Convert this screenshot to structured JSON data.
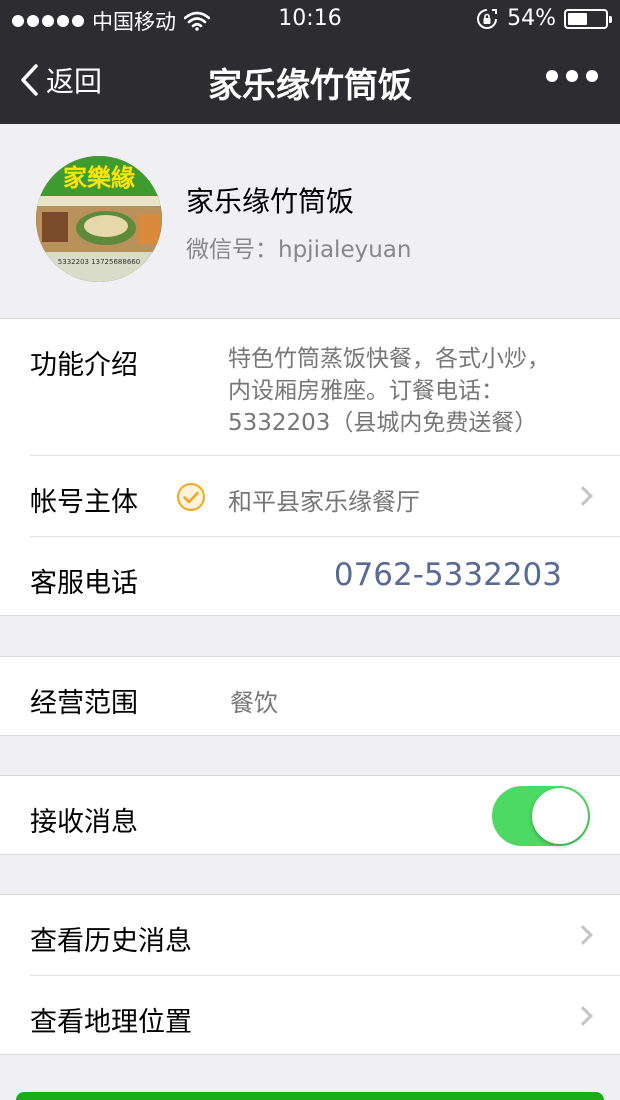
{
  "status_bar": {
    "carrier": "中国移动",
    "time": "10:16",
    "battery_percent": "54%",
    "battery_level": 0.54
  },
  "nav": {
    "back_label": "返回",
    "title": "家乐缘竹筒饭",
    "more_icon": "more-icon"
  },
  "profile": {
    "name": "家乐缘竹筒饭",
    "wechat_id": "微信号：hpjialeyuan",
    "avatar": {
      "sign_text": "家樂緣",
      "phone_text": "5332203  13725688660",
      "colors": {
        "sign_bg": "#3e9b2f",
        "sign_text": "#ffe400"
      }
    }
  },
  "info": {
    "intro_label": "功能介绍",
    "intro_lines": [
      "特色竹筒蒸饭快餐，各式小炒，",
      "内设厢房雅座。订餐电话：",
      "5332203（县城内免费送餐）"
    ],
    "account_label": "帐号主体",
    "account_value": "和平县家乐缘餐厅",
    "phone_label": "客服电话",
    "phone_value": "0762-5332203"
  },
  "scope": {
    "label": "经营范围",
    "value": "餐饮"
  },
  "message": {
    "label": "接收消息",
    "enabled": true
  },
  "links": {
    "history_label": "查看历史消息",
    "location_label": "查看地理位置"
  },
  "colors": {
    "navbar": "#2c2c31",
    "background": "#efeff4",
    "link_blue": "#576b95",
    "toggle_on": "#4cd964",
    "verified_orange": "#f5a623",
    "primary_button": "#1aad19"
  }
}
